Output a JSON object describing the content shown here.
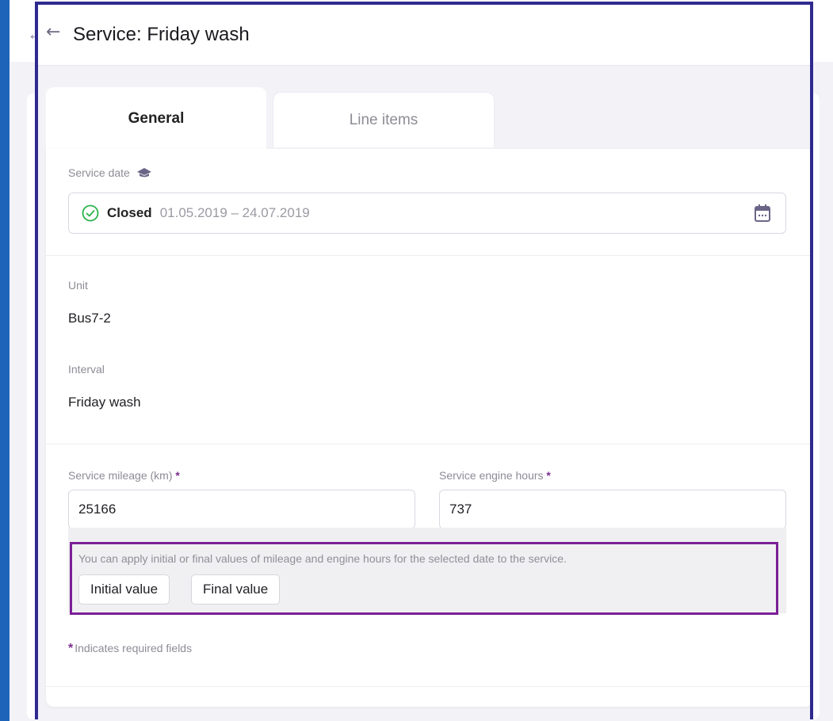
{
  "header": {
    "title": "Service: Friday wash"
  },
  "tabs": [
    {
      "label": "General",
      "active": true
    },
    {
      "label": "Line items",
      "active": false
    }
  ],
  "service_date": {
    "label": "Service date",
    "status": "Closed",
    "range": "01.05.2019 – 24.07.2019"
  },
  "unit": {
    "label": "Unit",
    "value": "Bus7-2"
  },
  "interval": {
    "label": "Interval",
    "value": "Friday wash"
  },
  "mileage": {
    "label": "Service mileage (km)",
    "required_mark": "*",
    "value": "25166"
  },
  "engine_hours": {
    "label": "Service engine hours",
    "required_mark": "*",
    "value": "737"
  },
  "hint": {
    "text": "You can apply initial or final values of mileage and engine hours for the selected date to the service.",
    "initial_button": "Initial value",
    "final_button": "Final value"
  },
  "required_note": {
    "mark": "*",
    "text": "Indicates required fields"
  },
  "colors": {
    "frame": "#2f2a8f",
    "highlight": "#7b1f96",
    "required": "#7c2f8f",
    "status_ok": "#2bb34a"
  },
  "icons": {
    "back": "arrow-left-icon",
    "status": "check-circle-icon",
    "calendar": "calendar-icon",
    "hat": "graduation-cap-icon"
  }
}
